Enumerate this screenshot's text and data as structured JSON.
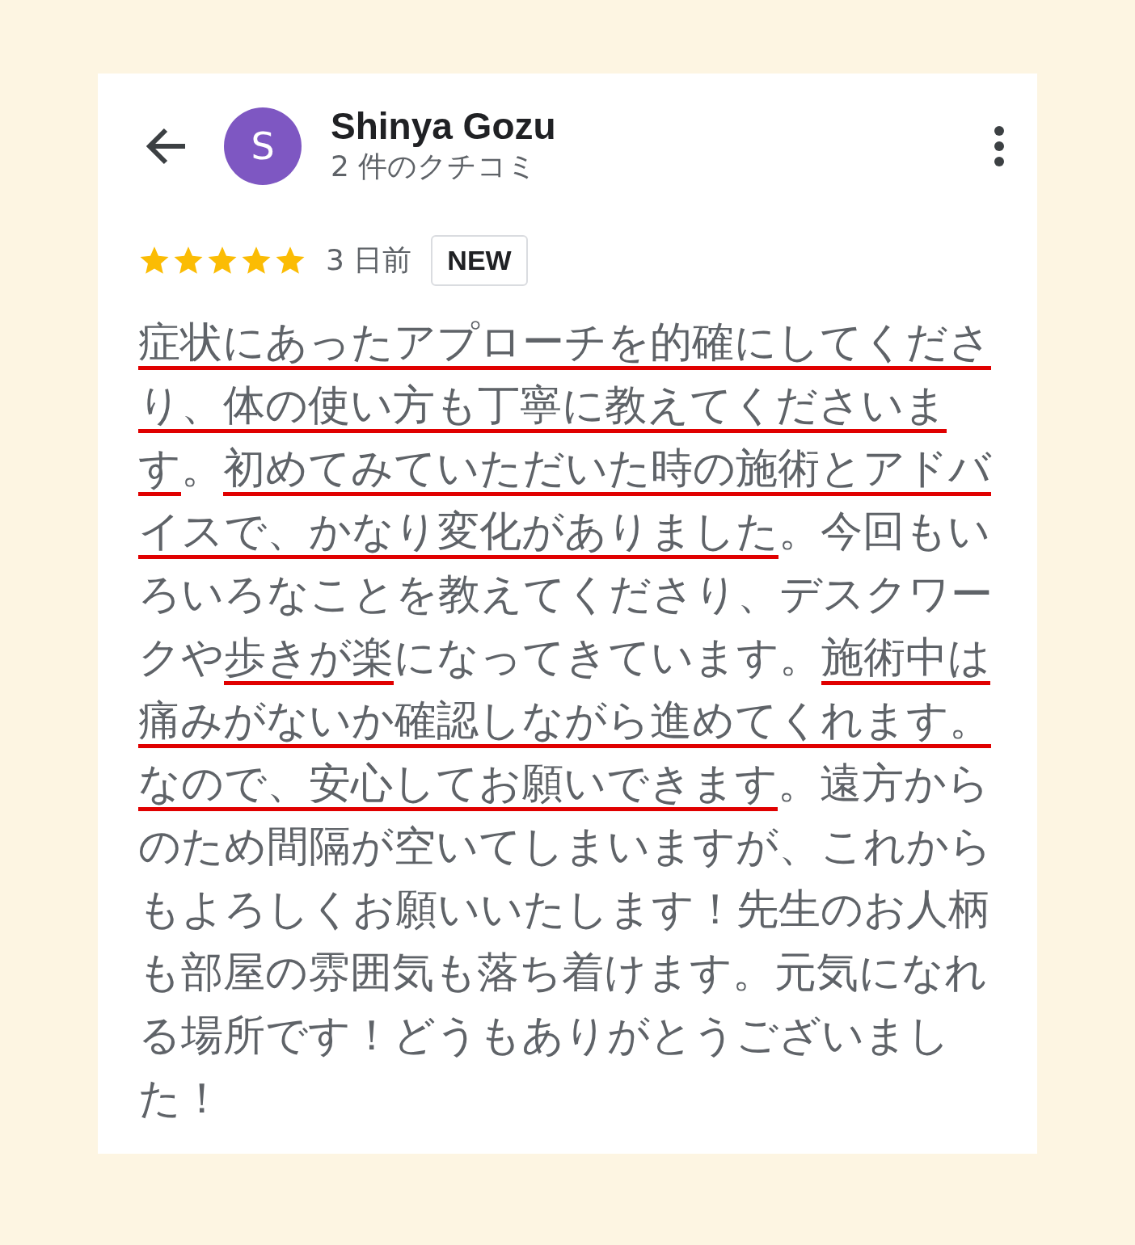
{
  "reviewer": {
    "name": "Shinya Gozu",
    "avatar_letter": "S",
    "review_count": "2 件のクチコミ"
  },
  "review": {
    "stars": 5,
    "time": "3 日前",
    "badge": "NEW",
    "segments": [
      {
        "text": "症状にあったアプローチを的確にしてくださり、体の使い方も丁寧に教えてくださいます",
        "underlined": true
      },
      {
        "text": "。",
        "underlined": false
      },
      {
        "text": "初めてみていただいた時の施術とアドバイスで、かなり変化がありました",
        "underlined": true
      },
      {
        "text": "。今回もいろいろなことを教えてくださり、デスクワークや",
        "underlined": false
      },
      {
        "text": "歩きが楽",
        "underlined": true
      },
      {
        "text": "になってきています。",
        "underlined": false
      },
      {
        "text": "施術中は痛みがないか確認しながら進めてくれます。なので、安心してお願いできます",
        "underlined": true
      },
      {
        "text": "。遠方からのため間隔が空いてしまいますが、これからもよろしくお願いいたします！先生のお人柄も部屋の雰囲気も落ち着けます。元気になれる場所です！どうもありがとうございました！",
        "underlined": false
      }
    ]
  }
}
